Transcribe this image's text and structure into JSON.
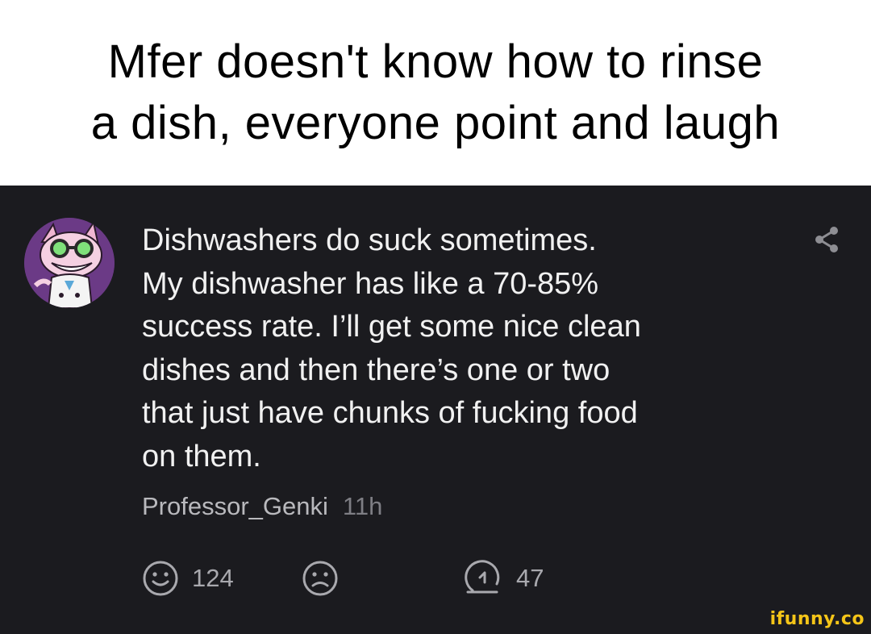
{
  "caption": {
    "line1": "Mfer doesn't know how to rinse",
    "line2": "a dish, everyone point and laugh"
  },
  "comment": {
    "lines": [
      "Dishwashers do suck sometimes.",
      "My dishwasher has like a 70-85%",
      "success rate. I’ll get some nice clean",
      "dishes and then there’s one or two",
      "that just have chunks of fucking food",
      "on them."
    ],
    "author": "Professor_Genki",
    "time": "11h",
    "avatar_icon": "cartoon-cat-avatar-icon",
    "share_icon": "share-icon"
  },
  "actions": {
    "smile_icon": "smile-icon",
    "smile_count": "124",
    "frown_icon": "frown-icon",
    "reply_icon": "reply-icon",
    "reply_count": "47"
  },
  "watermark": "ifunny.co",
  "colors": {
    "caption_bg": "#ffffff",
    "post_bg": "#1b1b1f",
    "text_primary": "#f1f1f1",
    "text_secondary": "#b9b9bd",
    "watermark": "#f5c518"
  }
}
